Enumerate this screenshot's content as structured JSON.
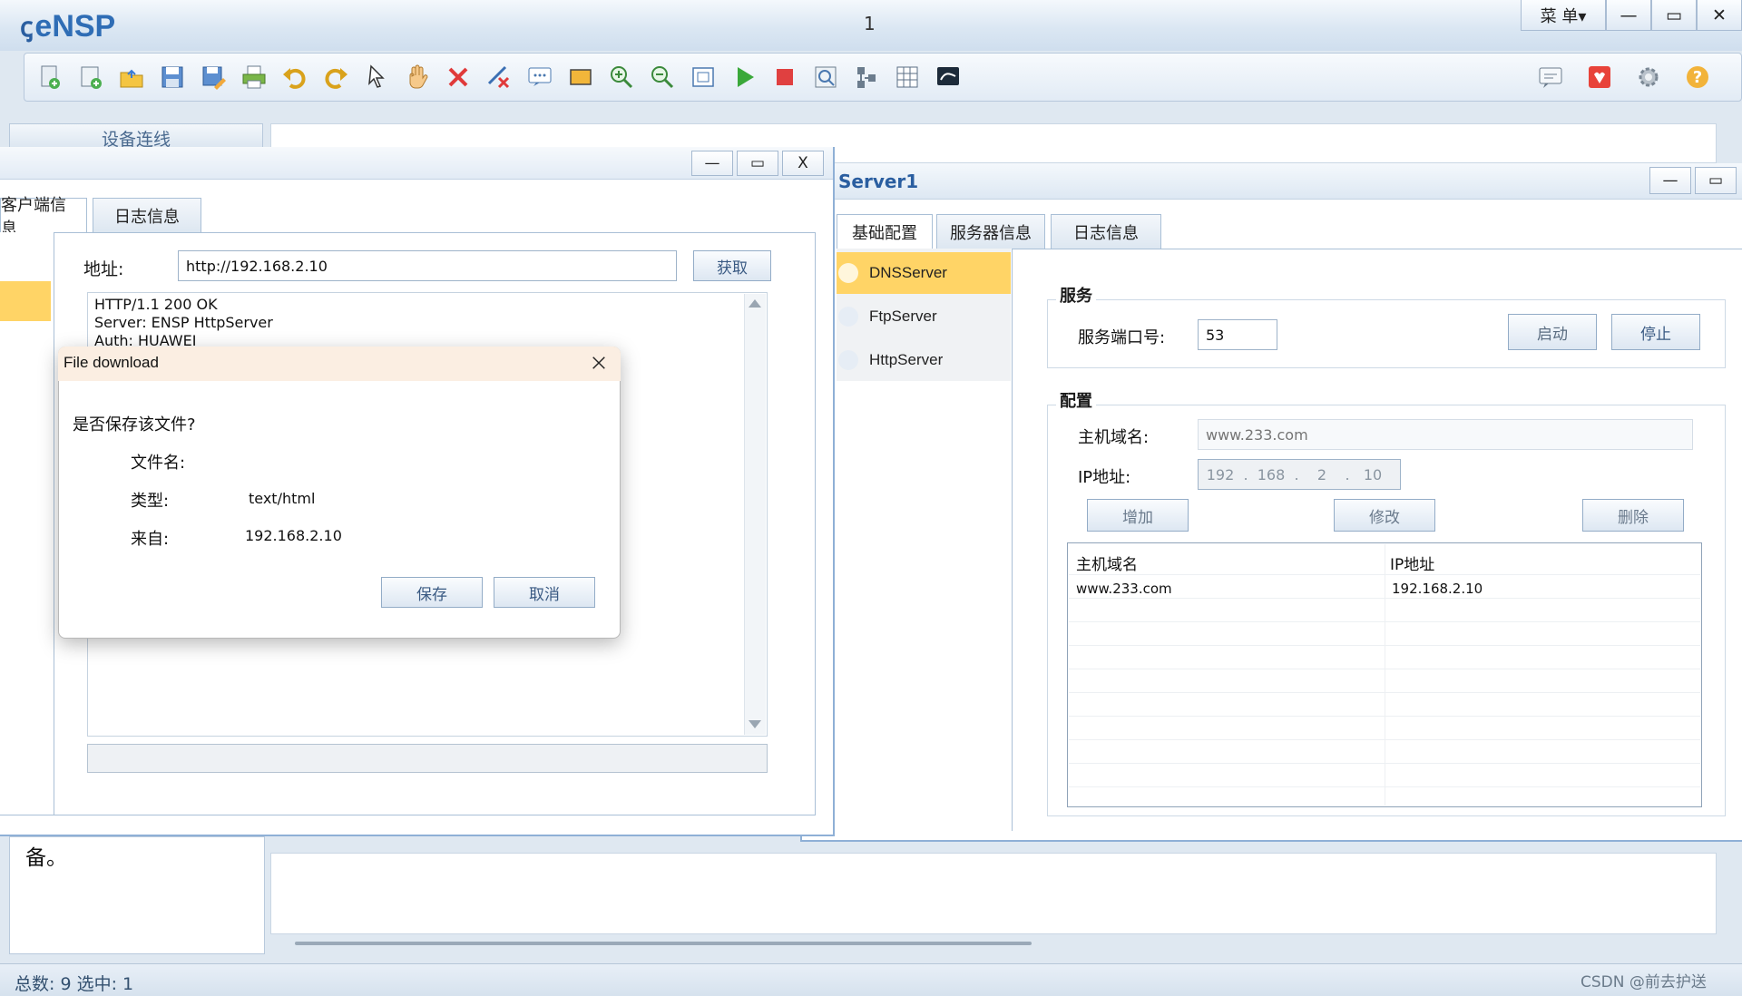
{
  "app": {
    "title": "eNSP",
    "window_number": "1",
    "menu_label": "菜 单▾",
    "minimize": "—",
    "maximize": "▭",
    "close": "✕"
  },
  "toolbar": {
    "icons": [
      "new-topology-icon",
      "new-device-icon",
      "open-icon",
      "save-icon",
      "save-as-icon",
      "print-icon",
      "undo-icon",
      "redo-icon",
      "select-icon",
      "pan-hand-icon",
      "delete-icon",
      "delete-link-icon",
      "text-label-icon",
      "rectangle-icon",
      "zoom-in-icon",
      "zoom-out-icon",
      "fit-view-icon",
      "start-device-icon",
      "stop-device-icon",
      "capture-icon",
      "topology-icon",
      "grid-icon",
      "console-icon",
      "chat-icon",
      "huawei-logo-icon",
      "settings-icon",
      "help-icon"
    ],
    "colors": {
      "start": "#3aa83a",
      "stop": "#e04040",
      "delete": "#e03a3a"
    }
  },
  "workspace": {
    "left_panel_tab": "设备连线",
    "left_bottom_text": "备。"
  },
  "statusbar": {
    "text": "总数: 9 选中: 1",
    "watermark": "CSDN @前去护送"
  },
  "client": {
    "controls": {
      "minimize": "—",
      "maximize": "▭",
      "close": "X"
    },
    "tabs": [
      "客户端信息",
      "日志信息"
    ],
    "address_label": "地址:",
    "address_value": "http://192.168.2.10",
    "get_button": "获取",
    "response": "HTTP/1.1 200 OK\nServer: ENSP HttpServer\nAuth: HUAWEI"
  },
  "download_dialog": {
    "title": "File download",
    "question": "是否保存该文件?",
    "filename_label": "文件名:",
    "filename_value": "",
    "type_label": "类型:",
    "type_value": "text/html",
    "from_label": "来自:",
    "from_value": "192.168.2.10",
    "save_button": "保存",
    "cancel_button": "取消"
  },
  "server": {
    "title": "Server1",
    "controls": {
      "minimize": "—",
      "maximize": "▭"
    },
    "tabs": [
      "基础配置",
      "服务器信息",
      "日志信息"
    ],
    "services": [
      "DNSServer",
      "FtpServer",
      "HttpServer"
    ],
    "selected_service": "DNSServer",
    "service_group": "服务",
    "port_label": "服务端口号:",
    "port_value": "53",
    "start_button": "启动",
    "stop_button": "停止",
    "config_group": "配置",
    "domain_label": "主机域名:",
    "domain_placeholder": "www.233.com",
    "ip_label": "IP地址:",
    "ip_octets": [
      "192",
      "168",
      "2",
      "10"
    ],
    "add_button": "增加",
    "modify_button": "修改",
    "delete_button": "删除",
    "table": {
      "columns": [
        "主机域名",
        "IP地址"
      ],
      "rows": [
        [
          "www.233.com",
          "192.168.2.10"
        ]
      ]
    }
  }
}
